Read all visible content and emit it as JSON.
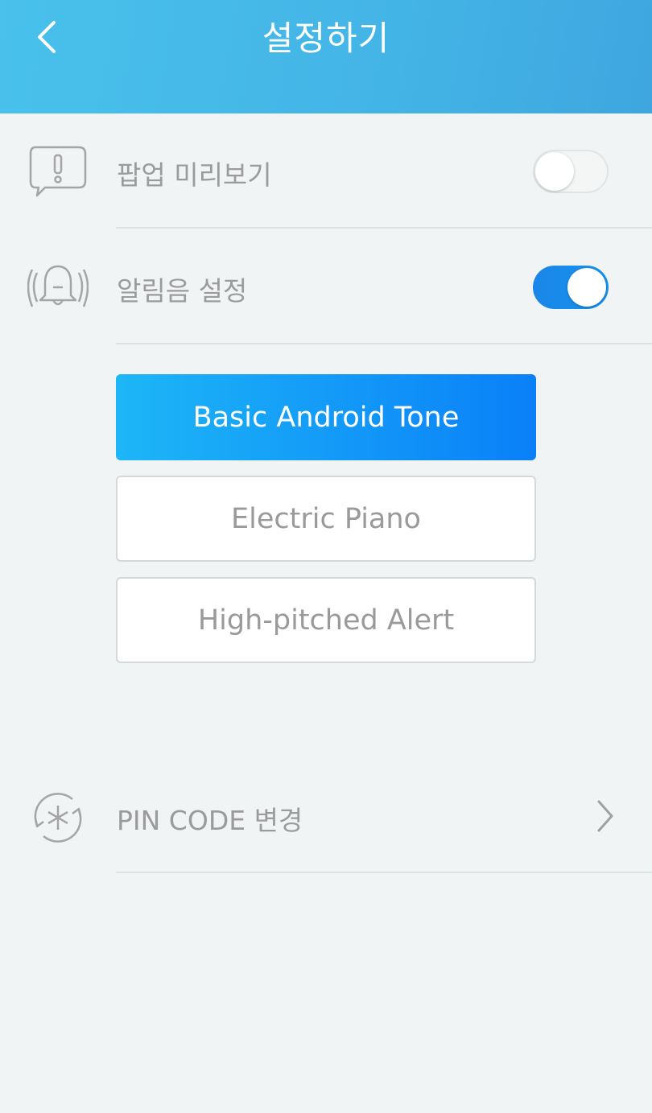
{
  "header": {
    "title": "설정하기",
    "back_icon": "chevron-left-icon"
  },
  "settings": {
    "popup_preview": {
      "label": "팝업 미리보기",
      "icon": "speech-bubble-exclamation-icon",
      "enabled": false
    },
    "sound_settings": {
      "label": "알림음 설정",
      "icon": "bell-ringing-icon",
      "enabled": true
    },
    "tones": [
      {
        "label": "Basic Android Tone",
        "selected": true
      },
      {
        "label": "Electric Piano",
        "selected": false
      },
      {
        "label": "High-pitched Alert",
        "selected": false
      }
    ],
    "pin_code": {
      "label": "PIN CODE 변경",
      "icon": "pin-refresh-icon",
      "arrow_icon": "chevron-right-icon"
    }
  },
  "colors": {
    "header_gradient_start": "#49c1ec",
    "toggle_on": "#1a86e8",
    "tone_active_start": "#1db6f7",
    "tone_active_end": "#0a80f8",
    "label_gray": "#9b9b9b",
    "background": "#f0f4f4"
  }
}
